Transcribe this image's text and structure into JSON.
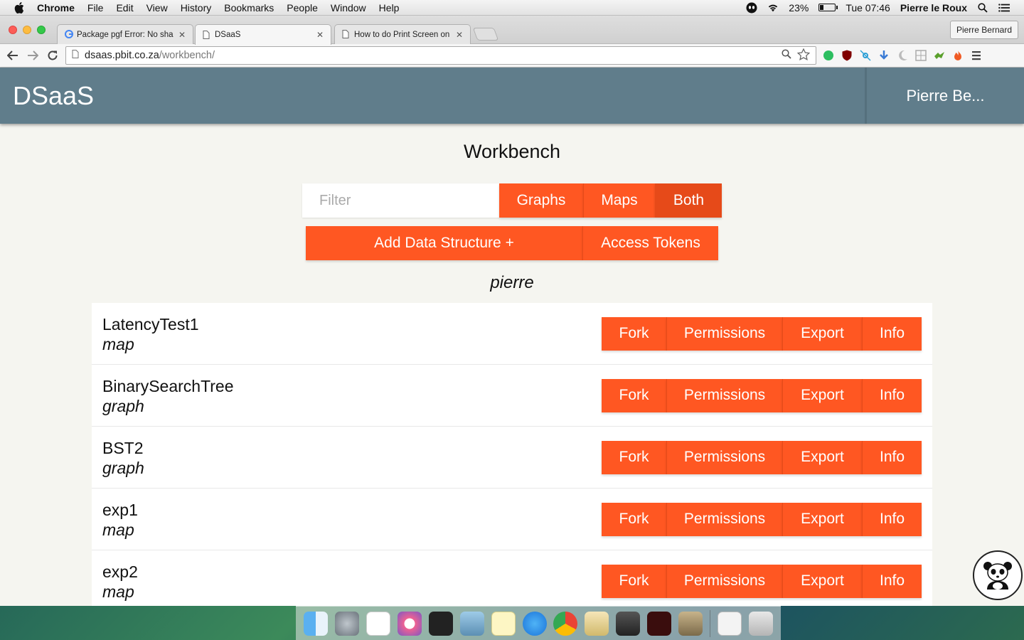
{
  "menubar": {
    "app": "Chrome",
    "items": [
      "File",
      "Edit",
      "View",
      "History",
      "Bookmarks",
      "People",
      "Window",
      "Help"
    ],
    "battery": "23%",
    "clock": "Tue 07:46",
    "user": "Pierre le Roux"
  },
  "browser": {
    "tabs": [
      {
        "title": "Package pgf Error: No sha"
      },
      {
        "title": "DSaaS"
      },
      {
        "title": "How to do Print Screen on"
      }
    ],
    "profile": "Pierre Bernard",
    "url_host": "dsaas.pbit.co.za",
    "url_path": "/workbench/"
  },
  "app": {
    "brand": "DSaaS",
    "user": "Pierre Be...",
    "title": "Workbench",
    "filter_placeholder": "Filter",
    "filter_buttons": {
      "graphs": "Graphs",
      "maps": "Maps",
      "both": "Both"
    },
    "add_button": "Add Data Structure +",
    "tokens_button": "Access Tokens",
    "owner": "pierre",
    "actions": {
      "fork": "Fork",
      "permissions": "Permissions",
      "export": "Export",
      "info": "Info"
    },
    "items": [
      {
        "name": "LatencyTest1",
        "type": "map"
      },
      {
        "name": "BinarySearchTree",
        "type": "graph"
      },
      {
        "name": "BST2",
        "type": "graph"
      },
      {
        "name": "exp1",
        "type": "map"
      },
      {
        "name": "exp2",
        "type": "map"
      }
    ]
  },
  "colors": {
    "header": "#607d8b",
    "accent": "#ff5722",
    "accent_selected": "#e64a19"
  }
}
